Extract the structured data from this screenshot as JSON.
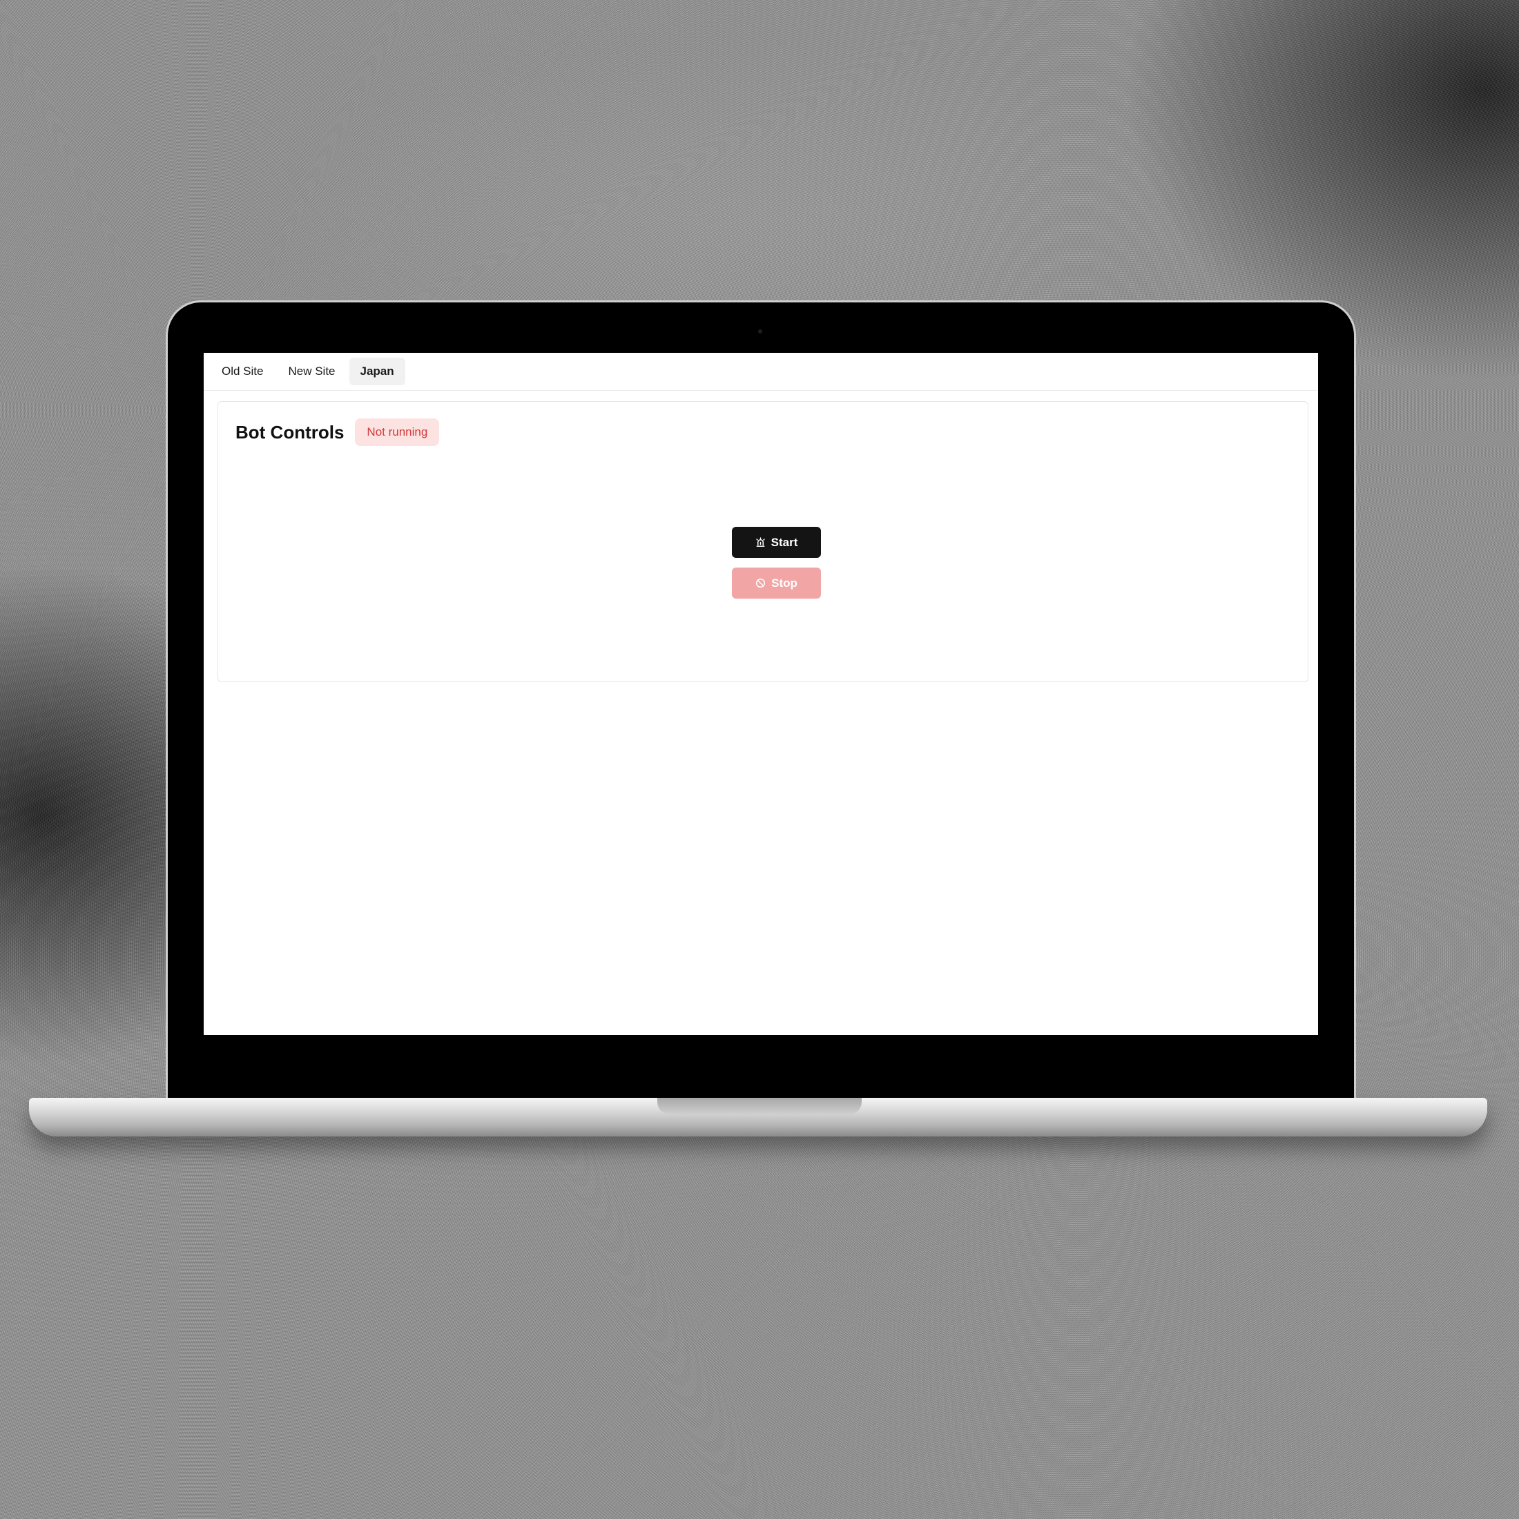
{
  "tabs": [
    {
      "label": "Old Site",
      "active": false
    },
    {
      "label": "New Site",
      "active": false
    },
    {
      "label": "Japan",
      "active": true
    }
  ],
  "card": {
    "title": "Bot Controls",
    "status_badge": "Not running"
  },
  "buttons": {
    "start_label": "Start",
    "start_icon": "siren-icon",
    "stop_label": "Stop",
    "stop_icon": "ban-icon"
  },
  "colors": {
    "start_bg": "#141414",
    "stop_bg": "#f2a5a5",
    "badge_bg": "#fde2e2",
    "badge_text": "#d23b3b"
  }
}
